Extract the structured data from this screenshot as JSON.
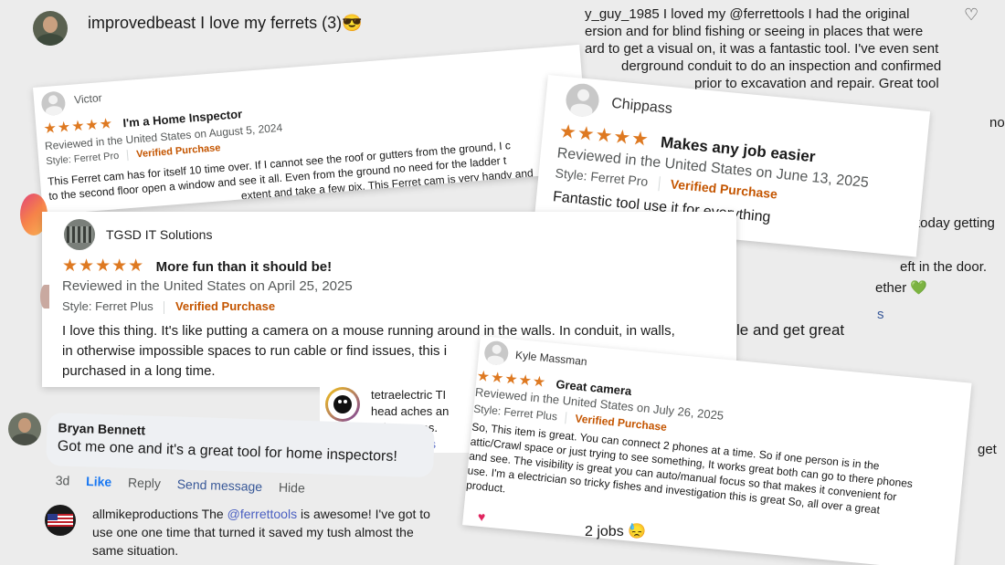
{
  "comment_top": {
    "username": "improvedbeast",
    "text": "I love my ferrets (3)😎"
  },
  "comment_guy": {
    "lines": [
      "y_guy_1985 I loved my @ferrettools I had the original",
      "ersion and for blind fishing or seeing in places that were",
      "ard to get a visual on, it was a fantastic tool. I've even sent",
      "derground conduit to do an inspection and confirmed",
      "prior to excavation and repair. Great tool"
    ],
    "heart": "♡"
  },
  "right_fragments": {
    "f1": "no",
    "f2": "today getting",
    "f3": "eft in the door.",
    "f4": "ether 💚",
    "f5": "s",
    "f6": "le and get great",
    "f7": "get"
  },
  "review_victor": {
    "name": "Victor",
    "stars": "★★★★★",
    "title": "I'm a Home Inspector",
    "reviewed": "Reviewed in the United States on August 5, 2024",
    "style": "Style: Ferret Pro",
    "verified": "Verified Purchase",
    "lines": [
      "This Ferret cam has for itself 10 time over. If I cannot see the roof or gutters from the ground, I c",
      "to the second floor open a window and see it all. Even from the ground no need for the ladder t",
      "extent and take a few pix. This Ferret cam is very handy and"
    ]
  },
  "review_chippass": {
    "name": "Chippass",
    "stars": "★★★★★",
    "title": "Makes any job easier",
    "reviewed": "Reviewed in the United States on June 13, 2025",
    "style": "Style: Ferret Pro",
    "verified": "Verified Purchase",
    "body": "Fantastic tool use it for everything"
  },
  "review_tgsd": {
    "name": "TGSD IT Solutions",
    "stars": "★★★★★",
    "title": "More fun than it should be!",
    "reviewed": "Reviewed in the United States on April 25, 2025",
    "style": "Style: Ferret Plus",
    "verified": "Verified Purchase",
    "lines": [
      "I love this thing. It's like putting a camera on a mouse running around in the walls. In conduit, in walls,",
      "in otherwise impossible spaces to run cable or find issues, this i",
      "purchased in a long time."
    ]
  },
  "comment_tetra": {
    "lines": [
      "tetraelectric TI",
      "head aches an",
      "tight spaces."
    ],
    "link": "@ferrettools"
  },
  "review_kyle": {
    "name": "Kyle Massman",
    "stars": "★★★★★",
    "title": "Great camera",
    "reviewed": "Reviewed in the United States on July 26, 2025",
    "style": "Style: Ferret Plus",
    "verified": "Verified Purchase",
    "lines": [
      "So, This item is great. You can connect 2 phones at a time. So if one person is in the",
      "attic/Crawl space or just trying to see something, It works great both can go to there phones",
      "and see. The visibility is great you can auto/manual focus so that makes it convenient for",
      "use. I'm a electrician so tricky fishes and investigation this is great So, all over a great",
      "product."
    ]
  },
  "comment_bryan": {
    "name": "Bryan Bennett",
    "text": "Got me one and it's a great tool for home inspectors!",
    "time": "3d",
    "like": "Like",
    "reply": "Reply",
    "send": "Send message",
    "hide": "Hide"
  },
  "comment_allmike": {
    "username": "allmikeproductions",
    "pre": "The ",
    "mention": "@ferrettools",
    "post": " is awesome! I've got to",
    "line2": "use one one time that turned it saved my tush almost the",
    "line3": "same situation."
  },
  "misc": {
    "heart_small": "♥",
    "jobs": "2 jobs 😓"
  }
}
